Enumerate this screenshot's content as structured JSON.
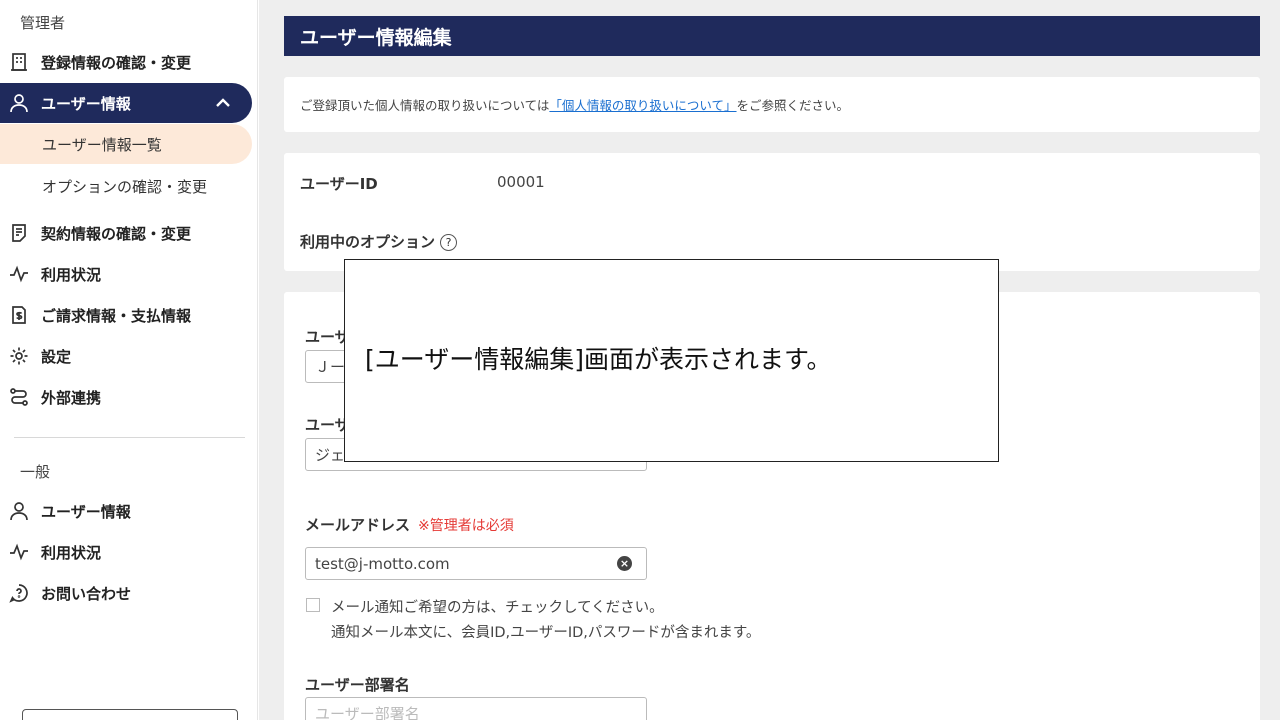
{
  "sidebar": {
    "admin_section_label": "管理者",
    "general_section_label": "一般",
    "items": {
      "registration": "登録情報の確認・変更",
      "user_info": "ユーザー情報",
      "user_list": "ユーザー情報一覧",
      "options": "オプションの確認・変更",
      "contract": "契約情報の確認・変更",
      "usage": "利用状況",
      "billing": "ご請求情報・支払情報",
      "settings": "設定",
      "integration": "外部連携",
      "general_user_info": "ユーザー情報",
      "general_usage": "利用状況",
      "contact": "お問い合わせ"
    }
  },
  "header": {
    "title": "ユーザー情報編集"
  },
  "notice": {
    "prefix": "ご登録頂いた個人情報の取り扱いについては",
    "link": "「個人情報の取り扱いについて」",
    "suffix": "をご参照ください。"
  },
  "info": {
    "user_id_label": "ユーザーID",
    "user_id_value": "00001",
    "options_label": "利用中のオプション",
    "help_glyph": "?"
  },
  "form": {
    "field1_label_partial": "ユーザ",
    "field1_value_partial": "Ｊー",
    "field2_label_partial": "ユーザ",
    "field2_value_partial": "ジェ",
    "email_label": "メールアドレス",
    "email_required": "※管理者は必須",
    "email_value": "test@j-motto.com",
    "clear_glyph": "×",
    "notify_line1": "メール通知ご希望の方は、チェックしてください。",
    "notify_line2": "通知メール本文に、会員ID,ユーザーID,パスワードが含まれます。",
    "dept_label": "ユーザー部署名",
    "dept_placeholder": "ユーザー部署名"
  },
  "overlay": {
    "text": "[ユーザー情報編集]画面が表示されます。"
  },
  "colors": {
    "primary": "#1f2a5c",
    "active_sub": "#fde9d9",
    "link": "#1a6fd0",
    "required": "#e53935"
  }
}
